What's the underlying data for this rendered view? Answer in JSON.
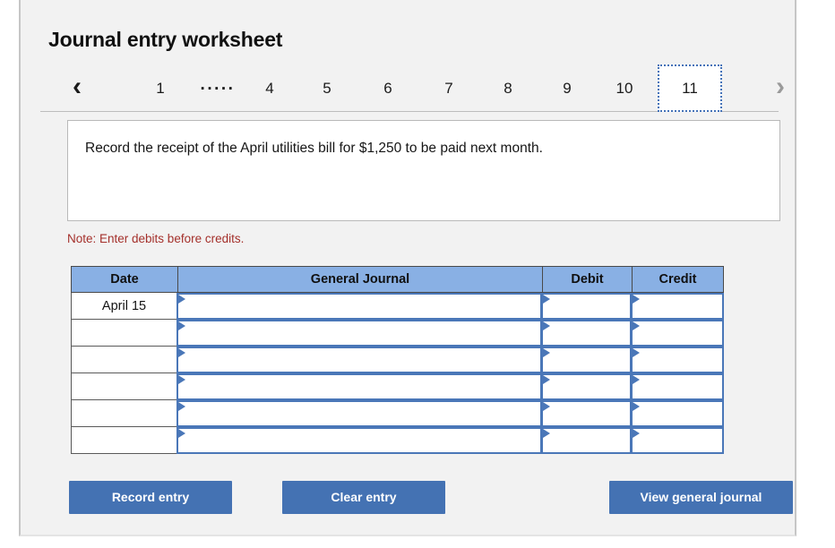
{
  "page": {
    "title": "Journal entry worksheet"
  },
  "pager": {
    "prev_icon": "chevron-left-icon",
    "next_icon": "chevron-right-icon",
    "ellipsis": ".....",
    "items": [
      {
        "label": "1",
        "active": false
      },
      {
        "label": "4",
        "active": false
      },
      {
        "label": "5",
        "active": false
      },
      {
        "label": "6",
        "active": false
      },
      {
        "label": "7",
        "active": false
      },
      {
        "label": "8",
        "active": false
      },
      {
        "label": "9",
        "active": false
      },
      {
        "label": "10",
        "active": false
      },
      {
        "label": "11",
        "active": true
      }
    ],
    "active_label": "11"
  },
  "instruction": {
    "text": "Record the receipt of the April utilities bill for $1,250 to be paid next month."
  },
  "note": {
    "text": "Note: Enter debits before credits."
  },
  "table": {
    "columns": [
      "Date",
      "General Journal",
      "Debit",
      "Credit"
    ],
    "rows": [
      {
        "date": "April 15",
        "general_journal": "",
        "debit": "",
        "credit": ""
      },
      {
        "date": "",
        "general_journal": "",
        "debit": "",
        "credit": ""
      },
      {
        "date": "",
        "general_journal": "",
        "debit": "",
        "credit": ""
      },
      {
        "date": "",
        "general_journal": "",
        "debit": "",
        "credit": ""
      },
      {
        "date": "",
        "general_journal": "",
        "debit": "",
        "credit": ""
      },
      {
        "date": "",
        "general_journal": "",
        "debit": "",
        "credit": ""
      }
    ]
  },
  "buttons": {
    "record": "Record entry",
    "clear": "Clear entry",
    "view": "View general journal"
  },
  "colors": {
    "button_blue": "#4472b3",
    "header_blue": "#89b0e4",
    "cell_border_blue": "#4a77b8",
    "note_red": "#a4302b",
    "card_bg": "#f2f2f2",
    "active_tab_border": "#4472b8"
  }
}
